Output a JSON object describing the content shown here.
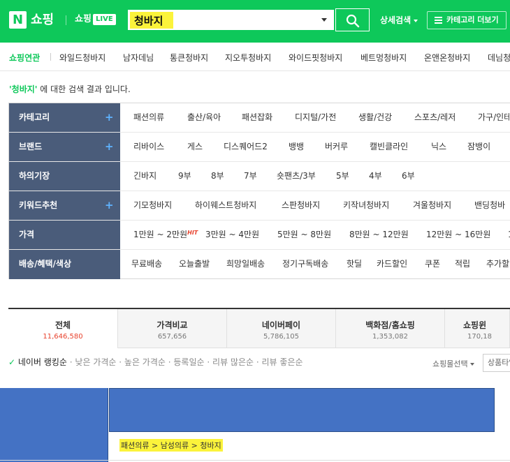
{
  "header": {
    "logo_mark": "N",
    "logo_text": "쇼핑",
    "live_text": "쇼핑",
    "live_badge": "LIVE",
    "search_value": "청바지",
    "detail_search": "상세검색",
    "category_more": "카테고리 더보기",
    "bg_color": "#0ec85a"
  },
  "related": {
    "title": "쇼핑연관",
    "items": [
      "와일드청바지",
      "남자데님",
      "통큰청바지",
      "지오투청바지",
      "와이드핏청바지",
      "베트멍청바지",
      "온앤온청바지",
      "데님청"
    ]
  },
  "result": {
    "keyword": "'청바지'",
    "message": " 에 대한 검색 결과 입니다."
  },
  "filters": [
    {
      "label": "카테고리",
      "plus": true,
      "options": [
        "패션의류",
        "출산/육아",
        "패션잡화",
        "디지털/가전",
        "생활/건강",
        "스포츠/레저",
        "가구/인테"
      ]
    },
    {
      "label": "브랜드",
      "plus": true,
      "options": [
        "리바이스",
        "게스",
        "디스퀘어드2",
        "뱅뱅",
        "버커루",
        "캘빈클라인",
        "닉스",
        "잠뱅이"
      ]
    },
    {
      "label": "하의기장",
      "plus": false,
      "options": [
        "긴바지",
        "9부",
        "8부",
        "7부",
        "숏팬츠/3부",
        "5부",
        "4부",
        "6부"
      ]
    },
    {
      "label": "키워드추천",
      "plus": true,
      "options": [
        "기모청바지",
        "하이웨스트청바지",
        "스판청바지",
        "키작녀청바지",
        "겨울청바지",
        "밴딩청바"
      ]
    },
    {
      "label": "가격",
      "plus": false,
      "options": [
        "1만원 ~ 2만원",
        "3만원 ~ 4만원",
        "5만원 ~ 8만원",
        "8만원 ~ 12만원",
        "12만원 ~ 16만원",
        "1"
      ],
      "hit_label": "HIT"
    },
    {
      "label": "배송/혜택/색상",
      "plus": false,
      "options": [
        "무료배송",
        "오늘출발",
        "희망일배송",
        "정기구독배송",
        "핫딜",
        "카드할인",
        "쿠폰",
        "적립",
        "추가할"
      ]
    }
  ],
  "tabs": [
    {
      "label": "전체",
      "count": "11,646,580"
    },
    {
      "label": "가격비교",
      "count": "657,656"
    },
    {
      "label": "네이버페이",
      "count": "5,786,105"
    },
    {
      "label": "백화점/홈쇼핑",
      "count": "1,353,082"
    },
    {
      "label": "쇼핑윈",
      "count": "170,18"
    }
  ],
  "sort": {
    "check": "✓",
    "options": [
      "네이버 랭킹순",
      "낮은 가격순",
      "높은 가격순",
      "등록일순",
      "리뷰 많은순",
      "리뷰 좋은순"
    ],
    "mall_select": "쇼핑몰선택",
    "product_type": "상품타입"
  },
  "product": {
    "breadcrumb": "패션의류 > 남성의류 > 청바지"
  },
  "colors": {
    "accent": "#0ec85a",
    "filter_head": "#4a5c7a",
    "highlight": "#fbf33b",
    "image_placeholder": "#4472c4"
  }
}
